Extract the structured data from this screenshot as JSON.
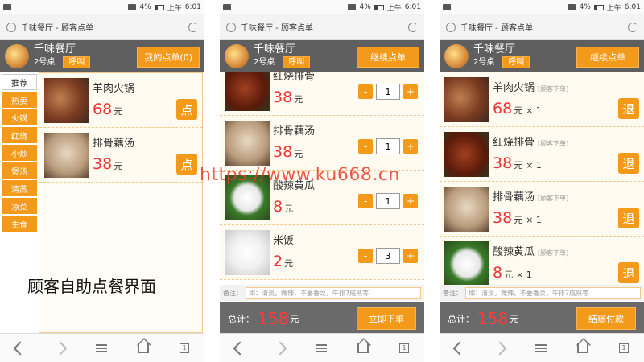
{
  "status": {
    "battery": "4%",
    "time_prefix": "上午",
    "time": "6:01"
  },
  "browser": {
    "page_title": "千味餐厅 - 顾客点单",
    "tabs_count": "1"
  },
  "restaurant": {
    "name": "千味餐厅",
    "table": "2号桌",
    "call_label": "呼叫"
  },
  "screen1": {
    "header_button": "我的点单(0)",
    "categories": [
      "推荐",
      "热卖",
      "火锅",
      "红烧",
      "小炒",
      "煲汤",
      "清蒸",
      "凉菜",
      "主食"
    ],
    "items": [
      {
        "name": "羊肉火锅",
        "price": "68",
        "unit": "元",
        "action": "点"
      },
      {
        "name": "排骨藕汤",
        "price": "38",
        "unit": "元",
        "action": "点"
      }
    ],
    "caption": "顾客自助点餐界面"
  },
  "screen2": {
    "header_button": "继续点单",
    "items": [
      {
        "name": "红烧排骨",
        "price": "38",
        "unit": "元",
        "qty": "1"
      },
      {
        "name": "排骨藕汤",
        "price": "38",
        "unit": "元",
        "qty": "1"
      },
      {
        "name": "酸辣黄瓜",
        "price": "8",
        "unit": "元",
        "qty": "1"
      },
      {
        "name": "米饭",
        "price": "2",
        "unit": "元",
        "qty": "3"
      }
    ],
    "notes_label": "备注：",
    "notes_placeholder": "如：清淡，微辣，不要香菜，牛排7成熟等",
    "total_label": "总计：",
    "total": "158",
    "total_unit": "元",
    "action": "立即下单",
    "minus": "-",
    "plus": "+"
  },
  "screen3": {
    "header_button": "继续点单",
    "items": [
      {
        "name": "羊肉火锅",
        "tag": "[顾客下单]",
        "price": "68",
        "unit": "元",
        "times": "× 1",
        "action": "退"
      },
      {
        "name": "红烧排骨",
        "tag": "[顾客下单]",
        "price": "38",
        "unit": "元",
        "times": "× 1",
        "action": "退"
      },
      {
        "name": "排骨藕汤",
        "tag": "[顾客下单]",
        "price": "38",
        "unit": "元",
        "times": "× 1",
        "action": "退"
      },
      {
        "name": "酸辣黄瓜",
        "tag": "[顾客下单]",
        "price": "8",
        "unit": "元",
        "times": "× 1",
        "action": "退"
      }
    ],
    "notes_label": "备注：",
    "notes_placeholder": "如：清淡，微辣，不要香菜，牛排7成熟等",
    "total_label": "总计：",
    "total": "158",
    "total_unit": "元",
    "action": "结账付款"
  },
  "watermark": "https://www.ku668.cn",
  "colors": {
    "accent": "#f39a1a",
    "header": "#5f5f5f",
    "price": "#ee3333"
  }
}
